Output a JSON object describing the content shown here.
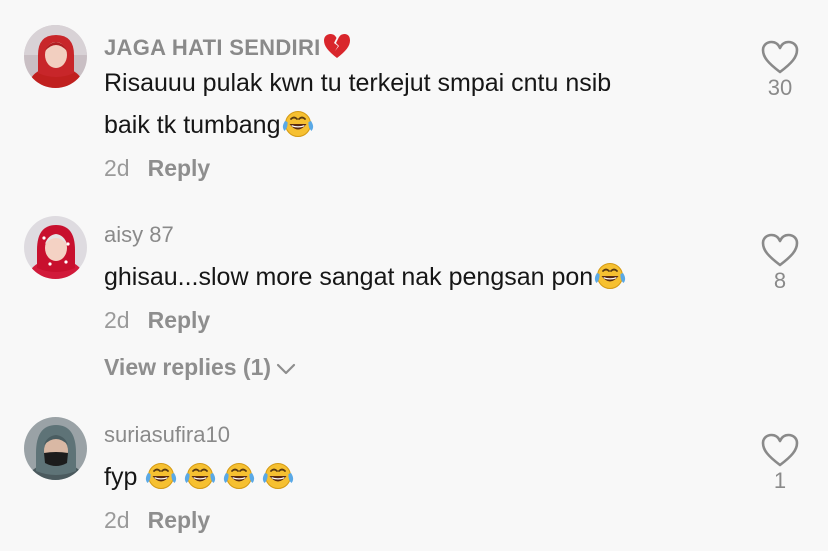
{
  "comments": [
    {
      "username": "JAGA HATI SENDIRI",
      "username_emoji": "broken-heart-emoji",
      "text_line1": "Risauuu pulak kwn tu terkejut smpai cntu nsib",
      "text_line2": "baik tk tumbang",
      "text_emoji": "tears-of-joy-emoji",
      "time": "2d",
      "reply_label": "Reply",
      "likes": "30"
    },
    {
      "username": "aisy 87",
      "text": "ghisau...slow more sangat nak pengsan pon",
      "text_emoji": "tears-of-joy-emoji",
      "time": "2d",
      "reply_label": "Reply",
      "likes": "8",
      "view_replies_label": "View replies (1)"
    },
    {
      "username": "suriasufira10",
      "text": "fyp",
      "text_emojis": [
        "tears-of-joy-emoji",
        "tears-of-joy-emoji",
        "tears-of-joy-emoji",
        "tears-of-joy-emoji"
      ],
      "time": "2d",
      "reply_label": "Reply",
      "likes": "1"
    }
  ],
  "colors": {
    "background": "#f8f8f8",
    "text": "#161616",
    "muted": "#8a8a8a",
    "emoji_yellow": "#f6c031",
    "tear_blue": "#5aa9e6",
    "broken_heart": "#d9262c"
  }
}
